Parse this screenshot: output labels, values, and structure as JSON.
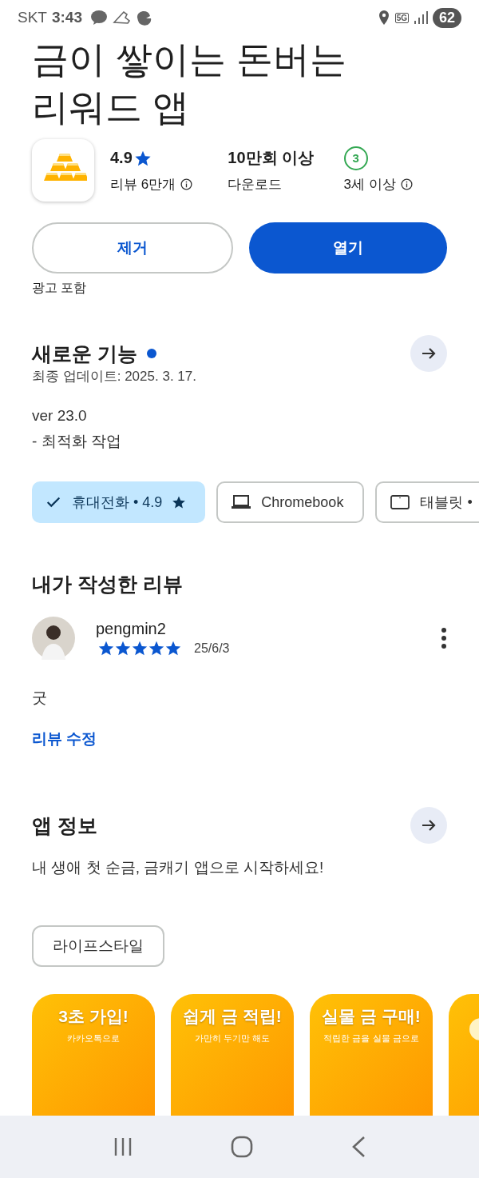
{
  "status_bar": {
    "carrier": "SKT",
    "time": "3:43",
    "network": "5G",
    "battery": "62"
  },
  "app": {
    "title_lines": [
      "금이 쌓이는 돈버는",
      "리워드 앱"
    ],
    "stats": [
      {
        "kind": "rating",
        "value": "4.9",
        "label": "리뷰 6만개",
        "info": true
      },
      {
        "kind": "plain",
        "value": "10만회 이상",
        "label": "다운로드",
        "info": false
      },
      {
        "kind": "age",
        "value": "3",
        "label": "3세 이상",
        "info": true
      }
    ]
  },
  "actions": [
    {
      "kind": "outline",
      "label": "제거"
    },
    {
      "kind": "filled",
      "label": "열기"
    }
  ],
  "ads_note": "광고 포함",
  "whats_new": {
    "title": "새로운 기능",
    "new_dot": true,
    "updated": "최종 업데이트: 2025. 3. 17.",
    "lines": [
      "ver 23.0",
      "- 최적화 작업"
    ]
  },
  "device_chips": [
    {
      "kind": "phone",
      "label": "휴대전화 • 4.9",
      "star": true,
      "selected": true
    },
    {
      "kind": "laptop",
      "label": "Chromebook",
      "star": false,
      "selected": false
    },
    {
      "kind": "tablet",
      "label": "태블릿 •",
      "selected": false
    }
  ],
  "my_review": {
    "title": "내가 작성한 리뷰",
    "user": "pengmin2",
    "stars": 5,
    "date": "25/6/3",
    "text": "굿",
    "edit_link": "리뷰 수정"
  },
  "app_info": {
    "title": "앱 정보",
    "description": "내 생애 첫 순금, 금캐기 앱으로 시작하세요!",
    "tag": "라이프스타일"
  },
  "screenshots": [
    {
      "title": "3초 가입!",
      "subtitle": "카카오톡으로"
    },
    {
      "title": "쉽게 금 적립!",
      "subtitle": "가만히 두기만 해도"
    },
    {
      "title": "실물 금 구매!",
      "subtitle": "적립한 금을 실물 금으로"
    },
    {
      "kind": "picture"
    }
  ]
}
